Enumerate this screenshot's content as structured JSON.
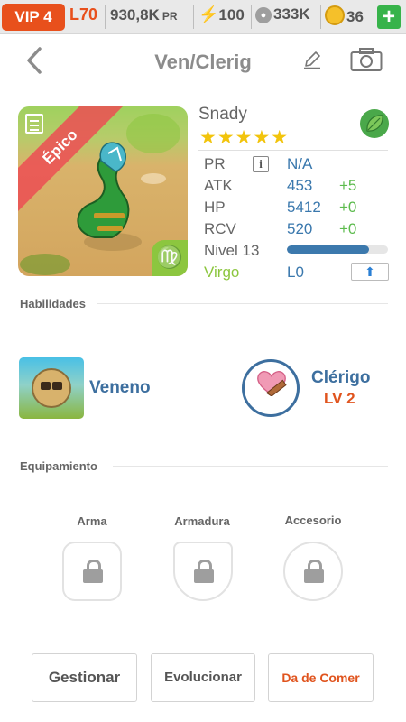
{
  "status_bar": {
    "vip": "VIP 4",
    "level": "L70",
    "power": "930,8K",
    "power_unit": "PR",
    "energy": "100",
    "food": "333K",
    "coins": "36",
    "add_label": "+"
  },
  "header": {
    "title": "Ven/Clerig"
  },
  "monster": {
    "rarity": "Épico",
    "name": "Snady",
    "stars": "★★★★★",
    "star_count": 5,
    "zodiac_symbol": "♍",
    "stats": [
      {
        "label": "PR",
        "value": "N/A",
        "bonus": ""
      },
      {
        "label": "ATK",
        "value": "453",
        "bonus": "+5"
      },
      {
        "label": "HP",
        "value": "5412",
        "bonus": "+0"
      },
      {
        "label": "RCV",
        "value": "520",
        "bonus": "+0"
      }
    ],
    "level_label": "Nivel 13",
    "level_progress": 0.81,
    "sign": "Virgo",
    "sign_level": "L0"
  },
  "sections": {
    "skills_title": "Habilidades",
    "equipment_title": "Equipamiento"
  },
  "skills": {
    "skill1_name": "Veneno",
    "skill2_name": "Clérigo",
    "skill2_level": "LV 2"
  },
  "equipment": {
    "weapon": "Arma",
    "armor": "Armadura",
    "accessory": "Accesorio"
  },
  "buttons": {
    "manage": "Gestionar",
    "evolve": "Evolucionar",
    "feed": "Da de Comer"
  },
  "colors": {
    "accent_orange": "#e8501c",
    "accent_blue": "#3d6f9f",
    "positive_green": "#5cbb4d",
    "star_gold": "#f2c40c"
  }
}
